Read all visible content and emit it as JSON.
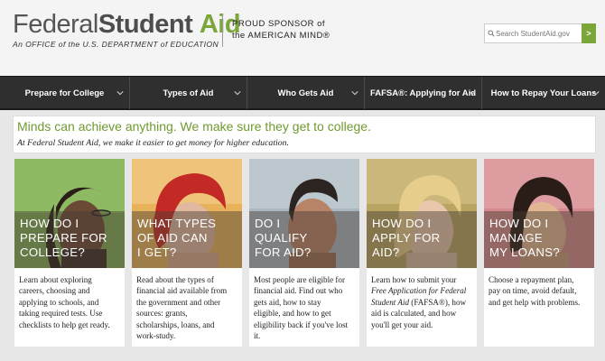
{
  "header": {
    "logo_word1": "Federal",
    "logo_word2": "Student",
    "logo_word3": "Aid",
    "logo_tagline": "An OFFICE of the U.S. DEPARTMENT of EDUCATION",
    "sponsor_line1": "PROUD SPONSOR of",
    "sponsor_line2": "the AMERICAN MIND®",
    "search_placeholder": "Search StudentAid.gov",
    "search_button": ">"
  },
  "nav": [
    {
      "label": "Prepare for College"
    },
    {
      "label": "Types of Aid"
    },
    {
      "label": "Who Gets Aid"
    },
    {
      "label": "FAFSA®: Applying for Aid"
    },
    {
      "label": "How to Repay Your Loans"
    }
  ],
  "intro": {
    "title": "Minds can achieve anything. We make sure they get to college.",
    "subtitle": "At Federal Student Aid, we make it easier to get money for higher education."
  },
  "cards": [
    {
      "title": [
        "HOW DO I",
        "PREPARE FOR",
        "COLLEGE?"
      ],
      "desc": [
        "Learn about exploring",
        "careers, choosing and",
        "applying to schools, and",
        "taking required tests.  Use",
        "checklists to help get ready."
      ],
      "bg": "#7fae56"
    },
    {
      "title": [
        "WHAT TYPES",
        "OF AID CAN",
        "I GET?"
      ],
      "desc": [
        "Read about the types of",
        "financial aid available from",
        "the government and other",
        "sources: grants,",
        "scholarships, loans, and",
        "work-study."
      ],
      "bg": "#e7b25a"
    },
    {
      "title": [
        "DO I",
        "QUALIFY",
        "FOR AID?"
      ],
      "desc": [
        "Most people are eligible for",
        "financial aid. Find out who",
        "gets aid, how to stay",
        "eligible, and how to get",
        "eligibility back if you've lost",
        "it."
      ],
      "bg": "#aab7c0"
    },
    {
      "title": [
        "HOW DO I",
        "APPLY FOR",
        "AID?"
      ],
      "desc_a": "Learn how to submit your",
      "desc_b": "Free Application for Federal",
      "desc_c": "Student Aid",
      "desc_d": " (FAFSA®), how",
      "desc_rest": [
        "aid is calculated, and how",
        "you'll get your aid."
      ],
      "bg": "#b9a461"
    },
    {
      "title": [
        "HOW DO I",
        "MANAGE",
        "MY LOANS?"
      ],
      "desc": [
        "Choose a repayment plan,",
        "pay on time, avoid default,",
        "and get help with problems."
      ],
      "bg": "#d48a8e"
    }
  ]
}
